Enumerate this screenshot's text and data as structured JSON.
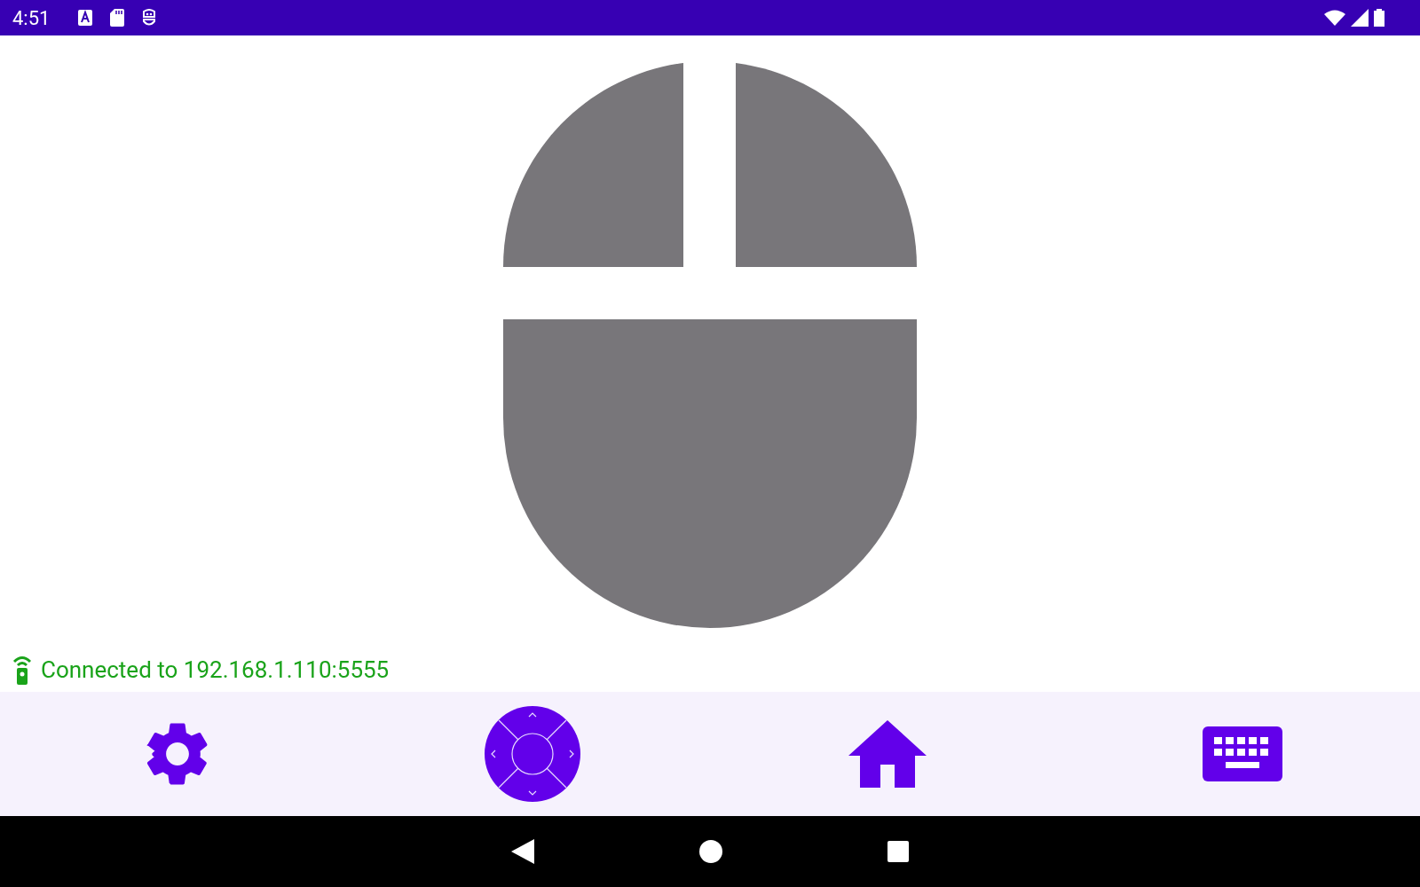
{
  "status_bar": {
    "time": "4:51"
  },
  "connection": {
    "text": "Connected to 192.168.1.110:5555",
    "connected": true
  },
  "bottom_nav": [
    {
      "kind": "settings"
    },
    {
      "kind": "dpad"
    },
    {
      "kind": "home"
    },
    {
      "kind": "keyboard"
    }
  ]
}
